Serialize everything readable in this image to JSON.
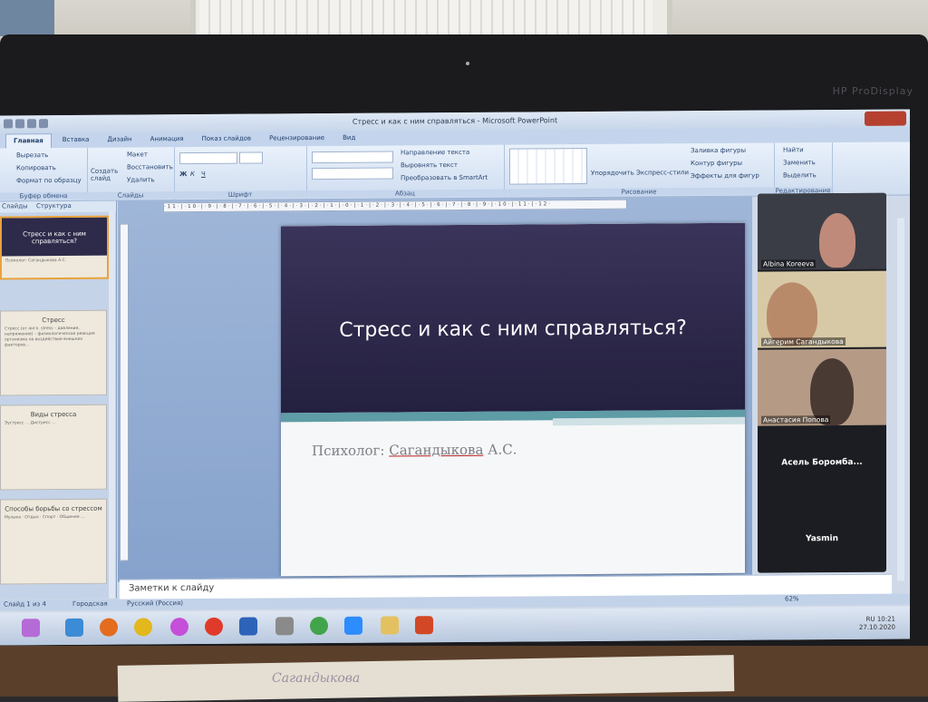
{
  "window": {
    "title": "Стресс и как с ним справляться - Microsoft PowerPoint",
    "monitor_brand": "HP ProDisplay"
  },
  "ribbon": {
    "tabs": [
      "Главная",
      "Вставка",
      "Дизайн",
      "Анимация",
      "Показ слайдов",
      "Рецензирование",
      "Вид"
    ],
    "active_tab": "Главная",
    "clipboard": {
      "label": "Буфер обмена",
      "cut": "Вырезать",
      "copy": "Копировать",
      "format": "Формат по образцу"
    },
    "slides": {
      "label": "Слайды",
      "new_slide": "Создать слайд",
      "layout": "Макет",
      "reset": "Восстановить",
      "delete": "Удалить"
    },
    "font": {
      "label": "Шрифт"
    },
    "paragraph": {
      "label": "Абзац",
      "text_direction": "Направление текста",
      "align_text": "Выровнять текст",
      "smartart": "Преобразовать в SmartArt"
    },
    "drawing": {
      "label": "Рисование",
      "arrange": "Упорядочить",
      "quick_styles": "Экспресс-стили",
      "fill": "Заливка фигуры",
      "outline": "Контур фигуры",
      "effects": "Эффекты для фигур"
    },
    "editing": {
      "label": "Редактирование",
      "find": "Найти",
      "replace": "Заменить",
      "select": "Выделить"
    }
  },
  "slide_pane": {
    "tabs": [
      "Слайды",
      "Структура"
    ],
    "thumbnails": [
      {
        "title": "Стресс и как с ним справляться?",
        "subtitle": "Психолог: Сагандыкова А.С."
      },
      {
        "title": "Стресс",
        "body": "Стресс (от англ. stress – давление, напряжение) – физиологическая реакция организма на воздействие внешних факторов..."
      },
      {
        "title": "Виды стресса",
        "body": "Эустресс ... Дистресс ..."
      },
      {
        "title": "Способы борьбы со стрессом",
        "body": "Музыка · Отдых · Спорт · Общение ..."
      }
    ]
  },
  "slide": {
    "title": "Стресс и как с ним справляться?",
    "subtitle_prefix": "Психолог: ",
    "subtitle_name": "Сагандыкова",
    "subtitle_suffix": " А.С."
  },
  "ruler": "·11·|·10·|·9·|·8·|·7·|·6·|·5·|·4·|·3·|·2·|·1·|·0·|·1·|·2·|·3·|·4·|·5·|·6·|·7·|·8·|·9·|·10·|·11·|·12·",
  "notes_placeholder": "Заметки к слайду",
  "status": {
    "slide": "Слайд 1 из 4",
    "theme": "Городская",
    "language": "Русский (Россия)",
    "zoom": "62%"
  },
  "participants": [
    {
      "name": "Albina Koreeva"
    },
    {
      "name": "Айгерим Сагандыкова"
    },
    {
      "name": "Анастасия Попова"
    },
    {
      "name": "Асель Боромба..."
    },
    {
      "name": "Yasmin"
    }
  ],
  "taskbar": {
    "clock": "10:21",
    "date": "27.10.2020",
    "lang": "RU"
  },
  "desk_paper": "Сагандыкова"
}
